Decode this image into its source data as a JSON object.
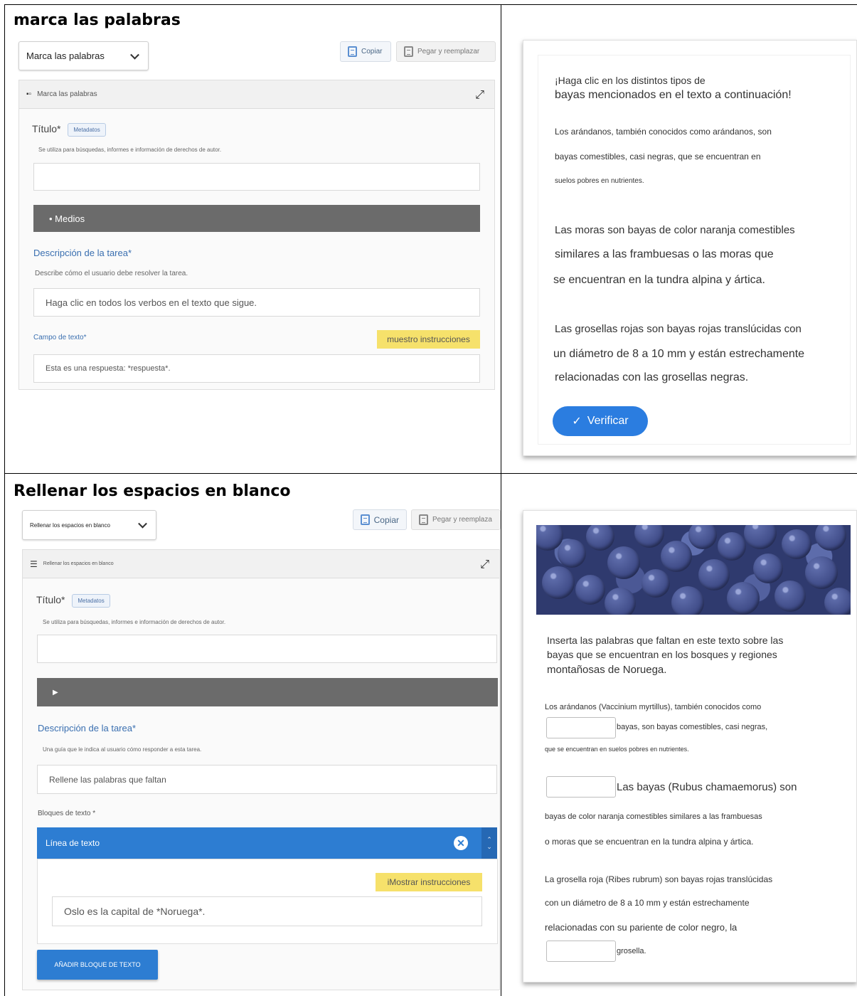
{
  "section1": {
    "heading": "marca las palabras",
    "editor": {
      "select_value": "Marca las palabras",
      "copy_label": "Copiar",
      "paste_label": "Pegar y reemplazar",
      "header_label": "Marca las palabras",
      "title_label": "Título*",
      "metadata_label": "Metadatos",
      "title_help": "Se utiliza para búsquedas, informes e información de derechos de autor.",
      "media_label": "• Medios",
      "task_label": "Descripción de la tarea*",
      "task_help": "Describe cómo el usuario debe resolver la tarea.",
      "task_value": "Haga clic en todos los verbos en el texto que sigue.",
      "textfield_label": "Campo de texto*",
      "show_instructions": "muestro instrucciones",
      "textfield_value": "Esta es una respuesta: *respuesta*."
    },
    "preview": {
      "intro_line1": "¡Haga clic en los distintos tipos de",
      "intro_line2": "bayas mencionados en el texto a continuación!",
      "p1_line1": "Los arándanos, también conocidos como arándanos, son",
      "p1_line2": "bayas comestibles, casi negras, que se encuentran en",
      "p1_line3": "suelos pobres en nutrientes.",
      "p2_line1": "Las moras son bayas de color naranja comestibles",
      "p2_line2": "similares a las frambuesas o las moras que",
      "p2_line3": "se encuentran en la tundra alpina y ártica.",
      "p3_line1": "Las grosellas rojas son bayas rojas translúcidas con",
      "p3_line2": "un diámetro de 8 a 10 mm y están estrechamente",
      "p3_line3": "relacionadas con las grosellas negras.",
      "verify_label": "Verificar",
      "verify_icon": "check-icon"
    }
  },
  "section2": {
    "heading": "Rellenar los espacios en blanco",
    "editor": {
      "select_value": "Rellenar los espacios en blanco",
      "copy_label": "Copiar",
      "paste_label": "Pegar y reemplaza",
      "header_label": "Rellenar los espacios en blanco",
      "title_label": "Título*",
      "metadata_label": "Metadatos",
      "title_help": "Se utiliza para búsquedas, informes e información de derechos de autor.",
      "task_label": "Descripción de la tarea*",
      "task_help": "Una guía que le indica al usuario cómo responder a esta tarea.",
      "task_value": "Rellene las palabras que faltan",
      "blocks_label": "Bloques de texto *",
      "line_label": "Línea de texto",
      "show_instructions": "iMostrar instrucciones",
      "line_value": "Oslo es la capital de *Noruega*.",
      "add_block_label": "AÑADIR BLOQUE DE TEXTO"
    },
    "preview": {
      "intro_line1": "Inserta las palabras que faltan en este texto sobre las",
      "intro_line2": "bayas que se encuentran en los bosques y regiones",
      "intro_line3": "montañosas de Noruega.",
      "p1_line1": "Los arándanos (Vaccinium myrtillus), también conocidos como",
      "p1_line2": "bayas, son bayas comestibles, casi negras,",
      "p1_line3": "que se encuentran en suelos pobres en nutrientes.",
      "p2_line1": "Las bayas (Rubus chamaemorus) son",
      "p2_line2": "bayas de color naranja comestibles similares a las frambuesas",
      "p2_line3": "o moras que se encuentran en la tundra alpina y ártica.",
      "p3_line1": "La grosella roja (Ribes rubrum) son bayas rojas translúcidas",
      "p3_line2": "con un diámetro de 8 a 10 mm y están estrechamente",
      "p3_line3": "relacionadas con su pariente de color negro, la",
      "p3_line4": "grosella."
    }
  }
}
